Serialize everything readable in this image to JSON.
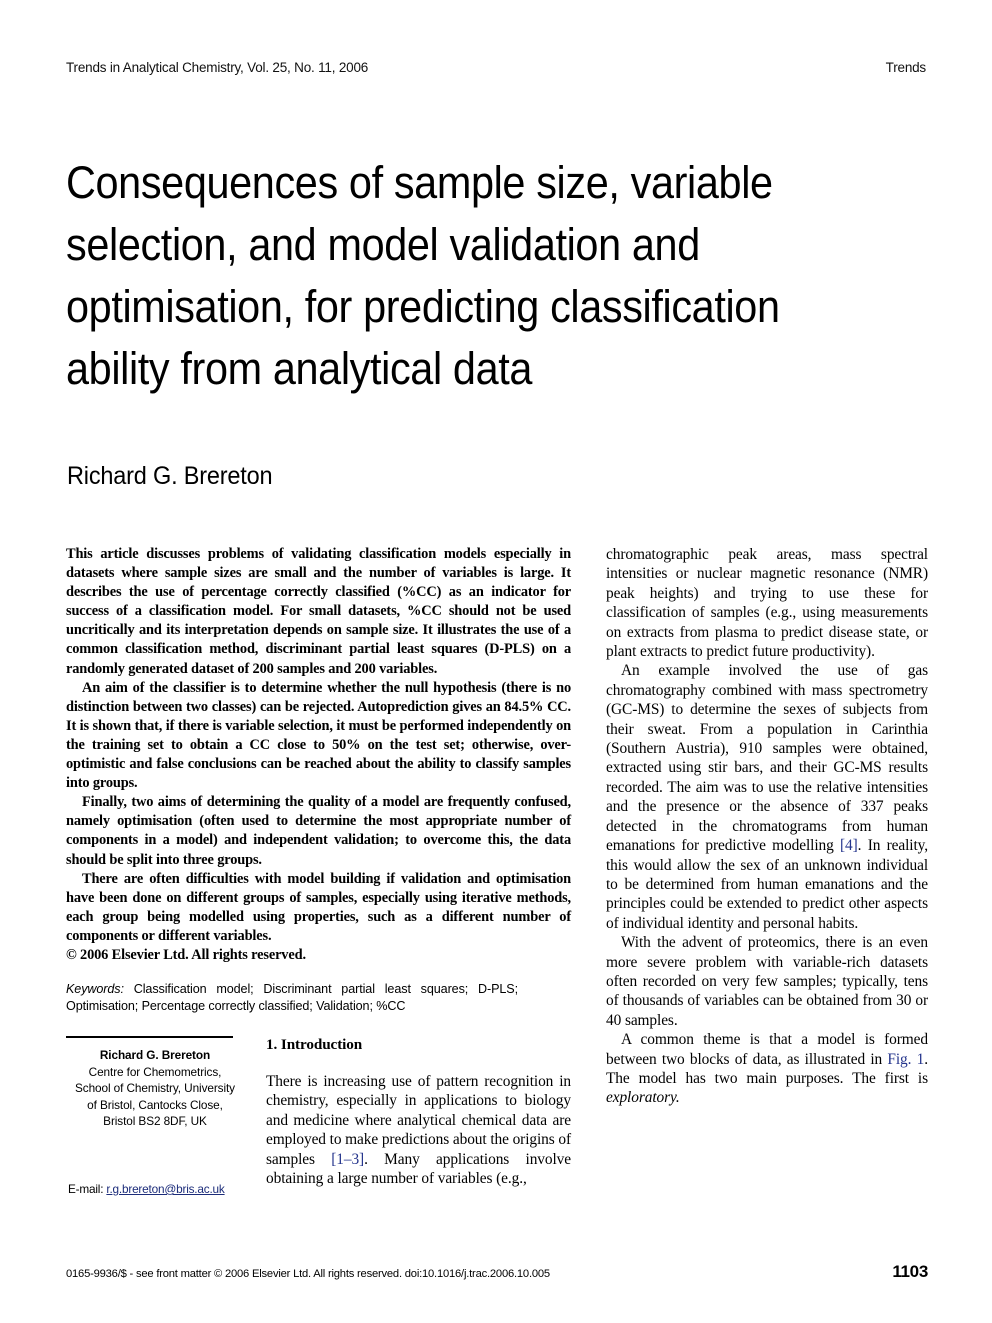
{
  "running_head": {
    "left": "Trends in Analytical Chemistry, Vol. 25, No. 11, 2006",
    "right": "Trends"
  },
  "article": {
    "title": "Consequences of sample size, variable selection, and model validation and optimisation, for predicting classification ability from analytical data",
    "author": "Richard G. Brereton"
  },
  "abstract": {
    "p1": "This article discusses problems of validating classification models especially in datasets where sample sizes are small and the number of variables is large. It describes the use of percentage correctly classified (%CC) as an indicator for success of a classification model. For small datasets, %CC should not be used uncritically and its interpretation depends on sample size. It illustrates the use of a common classification method, discriminant partial least squares (D-PLS) on a randomly generated dataset of 200 samples and 200 variables.",
    "p2": "An aim of the classifier is to determine whether the null hypothesis (there is no distinction between two classes) can be rejected. Autoprediction gives an 84.5% CC. It is shown that, if there is variable selection, it must be performed independently on the training set to obtain a CC close to 50% on the test set; otherwise, over-optimistic and false conclusions can be reached about the ability to classify samples into groups.",
    "p3": "Finally, two aims of determining the quality of a model are frequently confused, namely optimisation (often used to determine the most appropriate number of components in a model) and independent validation; to overcome this, the data should be split into three groups.",
    "p4": "There are often difficulties with model building if validation and optimisation have been done on different groups of samples, especially using iterative methods, each group being modelled using properties, such as a different number of components or different variables.",
    "copyright": "© 2006 Elsevier Ltd. All rights reserved."
  },
  "keywords": {
    "label": "Keywords:",
    "text": " Classification model; Discriminant partial least squares; D-PLS; Optimisation; Percentage correctly classified; Validation; %CC"
  },
  "affiliation": {
    "name": "Richard G. Brereton",
    "line1": "Centre for Chemometrics,",
    "line2": "School of Chemistry, University",
    "line3": "of Bristol, Cantocks Close,",
    "line4": "Bristol BS2 8DF, UK",
    "email_label": "E-mail: ",
    "email_address": "r.g.brereton@bris.ac.uk",
    "email_color": "#1c2c7a"
  },
  "introduction": {
    "heading": "1. Introduction",
    "p1_a": "There is increasing use of pattern recognition in chemistry, especially in applications to biology and medicine where analytical chemical data are employed to make predictions about the origins of samples ",
    "p1_ref": "[1–3]",
    "p1_b": ". Many applications involve obtaining a large number of variables (e.g.,"
  },
  "right_column": {
    "p1": "chromatographic peak areas, mass spectral intensities or nuclear magnetic resonance (NMR) peak heights) and trying to use these for classification of samples (e.g., using measurements on extracts from plasma to predict disease state, or plant extracts to predict future productivity).",
    "p2_a": "An example involved the use of gas chromatography combined with mass spectrometry (GC-MS) to determine the sexes of subjects from their sweat. From a population in Carinthia (Southern Austria), 910 samples were obtained, extracted using stir bars, and their GC-MS results recorded. The aim was to use the relative intensities and the presence or the absence of 337 peaks detected in the chromatograms from human emanations for predictive modelling ",
    "p2_ref": "[4]",
    "p2_b": ". In reality, this would allow the sex of an unknown individual to be determined from human emanations and the principles could be extended to predict other aspects of individual identity and personal habits.",
    "p3": "With the advent of proteomics, there is an even more severe problem with variable-rich datasets often recorded on very few samples; typically, tens of thousands of variables can be obtained from 30 or 40 samples.",
    "p4_a": "A common theme is that a model is formed between two blocks of data, as illustrated in ",
    "p4_ref": "Fig. 1",
    "p4_b": ". The model has two main purposes. The first is ",
    "p4_italic": "exploratory.",
    "link_color": "#24348c"
  },
  "footer": {
    "left": "0165-9936/$ - see front matter © 2006 Elsevier Ltd. All rights reserved.   doi:10.1016/j.trac.2006.10.005",
    "page_number": "1103"
  }
}
